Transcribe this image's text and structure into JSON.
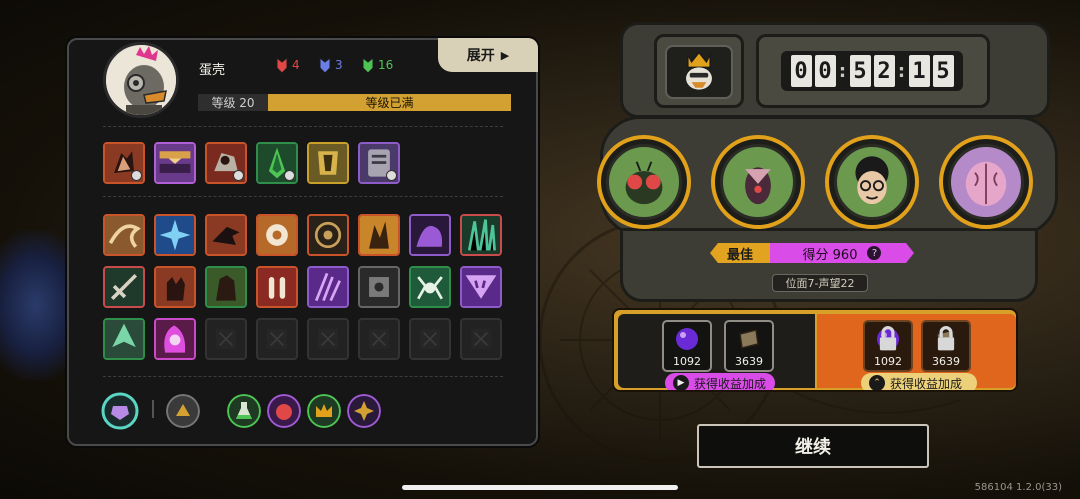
{
  "player": {
    "name": "蛋壳",
    "level_label": "等级 20",
    "level_status": "等级已满",
    "expand_label": "展开",
    "resources": [
      {
        "icon": "red-mask-icon",
        "value": "4",
        "color": "#e04848"
      },
      {
        "icon": "blue-mask-icon",
        "value": "3",
        "color": "#6a7fe6"
      },
      {
        "icon": "green-mask-icon",
        "value": "16",
        "color": "#4ec455"
      }
    ]
  },
  "skills": {
    "row1_icons": [
      "claw-skill-icon",
      "bar-skill-icon",
      "fist-skill-icon",
      "leaf-skill-icon",
      "armor-skill-icon",
      "plate-skill-icon"
    ],
    "grid_icons": [
      "swirl-icon",
      "star-icon",
      "bird-icon",
      "gear-icon",
      "target-icon",
      "flame-icon",
      "splash-icon",
      "grass-icon",
      "sword-icon",
      "hand-icon",
      "monster-icon",
      "bullets-icon",
      "claw-icon",
      "chip-icon",
      "spider-icon",
      "triangle-icon",
      "arrow-icon",
      "fire-fist-icon",
      "empty-slot-icon",
      "empty-slot-icon",
      "empty-slot-icon",
      "empty-slot-icon",
      "empty-slot-icon",
      "empty-slot-icon"
    ],
    "bottom_icons": [
      "amulet-icon",
      "boost-icon",
      "potion-icon",
      "punch-icon",
      "crown-icon",
      "spark-icon"
    ]
  },
  "machine": {
    "timer": [
      "0",
      "0",
      "5",
      "2",
      "1",
      "5"
    ],
    "best_label": "最佳",
    "score_label": "得分 960",
    "help_label": "?",
    "location_label": "位面7-声望22",
    "pods": [
      "fly-enemy-icon",
      "beetle-enemy-icon",
      "nerd-enemy-icon",
      "brain-enemy-icon"
    ]
  },
  "rewards": {
    "base": [
      {
        "icon": "purple-orb-icon",
        "value": "1092"
      },
      {
        "icon": "card-icon",
        "value": "3639"
      }
    ],
    "boosted": [
      {
        "icon": "purple-orb-icon",
        "value": "1092"
      },
      {
        "icon": "card-icon",
        "value": "3639"
      }
    ],
    "base_button": "获得收益加成",
    "boost_button": "获得收益加成"
  },
  "continue_label": "继续",
  "version": "586104 1.2.0(33)"
}
